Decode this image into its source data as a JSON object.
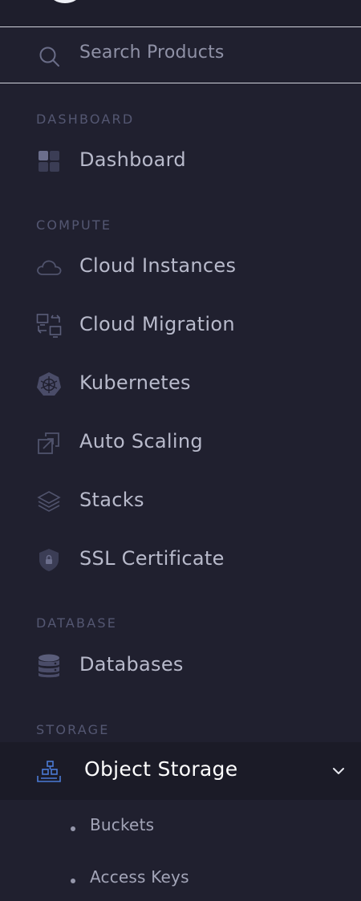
{
  "search": {
    "placeholder": "Search Products",
    "icon": "search-icon"
  },
  "sections": {
    "dashboard": "DASHBOARD",
    "compute": "COMPUTE",
    "database": "DATABASE",
    "storage": "STORAGE"
  },
  "items": {
    "dashboard": {
      "label": "Dashboard",
      "icon": "grid-icon"
    },
    "cloud_instances": {
      "label": "Cloud Instances",
      "icon": "cloud-icon"
    },
    "cloud_migration": {
      "label": "Cloud Migration",
      "icon": "migration-icon"
    },
    "kubernetes": {
      "label": "Kubernetes",
      "icon": "kubernetes-icon"
    },
    "auto_scaling": {
      "label": "Auto Scaling",
      "icon": "scaling-icon"
    },
    "stacks": {
      "label": "Stacks",
      "icon": "layers-icon"
    },
    "ssl_certificate": {
      "label": "SSL Certificate",
      "icon": "shield-lock-icon"
    },
    "databases": {
      "label": "Databases",
      "icon": "database-icon"
    },
    "object_storage": {
      "label": "Object Storage",
      "icon": "object-storage-icon",
      "expanded": true
    }
  },
  "object_storage_sub": [
    {
      "label": "Buckets"
    },
    {
      "label": "Access Keys"
    }
  ],
  "colors": {
    "background": "#20202f",
    "active_background": "#1b1b27",
    "accent": "#4b7bd6",
    "section_label": "#545772",
    "item_label": "#b8bacb"
  }
}
